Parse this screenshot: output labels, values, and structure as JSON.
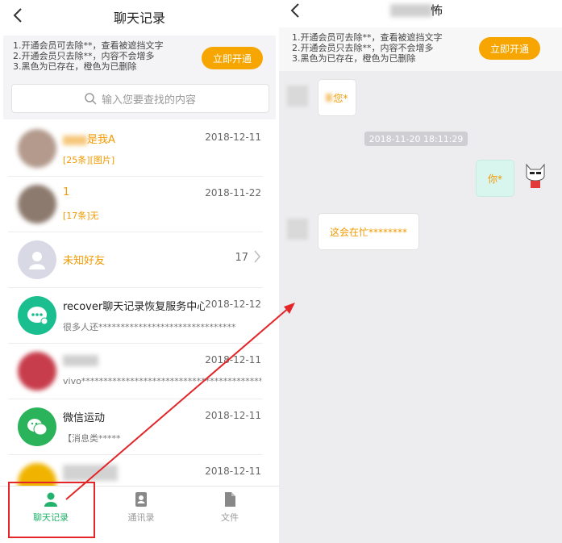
{
  "left": {
    "title": "聊天记录",
    "promo_lines": [
      "1.开通会员可去除**，查看被遮挡文字",
      "2.开通会员只去除**，内容不会增多",
      "3.黑色为已存在，橙色为已删除"
    ],
    "promo_button": "立即开通",
    "search_placeholder": "输入您要查找的内容",
    "chats": [
      {
        "name": "是我A",
        "sub": "[25条][图片]",
        "date": "2018-12-11",
        "deleted": true,
        "avatar": "#b39a8d"
      },
      {
        "name": "1",
        "sub": "[17条]无",
        "date": "2018-11-22",
        "deleted": true,
        "avatar": "#8d7a6e"
      },
      {
        "name": "未知好友",
        "sub": "",
        "count": "17",
        "deleted": true,
        "avatar": "#d9d9e6"
      },
      {
        "name": "recover聊天记录恢复服务中心",
        "sub": "很多人还*******************************",
        "date": "2018-12-12",
        "deleted": false,
        "avatar": "#1bbf8f"
      },
      {
        "name": "",
        "sub": "vivo******************************************",
        "date": "2018-12-11",
        "deleted": false,
        "avatar": "#c73d4b"
      },
      {
        "name": "微信运动",
        "sub": "【消息类*****",
        "date": "2018-12-11",
        "deleted": false,
        "avatar": "#2bb35c"
      },
      {
        "name": "",
        "sub": "",
        "date": "2018-12-11",
        "deleted": false,
        "avatar": "#f0b400"
      }
    ],
    "tabs": [
      {
        "label": "聊天记录",
        "icon": "person-icon",
        "active": true
      },
      {
        "label": "通讯录",
        "icon": "contacts-icon",
        "active": false
      },
      {
        "label": "文件",
        "icon": "file-icon",
        "active": false
      }
    ]
  },
  "right": {
    "title": "怖",
    "promo_lines": [
      "1.开通会员可去除**，查看被遮挡文字",
      "2.开通会员只去除**，内容不会增多",
      "3.黑色为已存在，橙色为已删除"
    ],
    "promo_button": "立即开通",
    "messages": [
      {
        "text": "您*",
        "side": "left"
      },
      {
        "text": "你*",
        "side": "right"
      },
      {
        "text": "这会在忙********",
        "side": "left"
      }
    ],
    "timestamp": "2018-11-20 18:11:29"
  },
  "colors": {
    "accent": "#f7a500",
    "active": "#21b36b",
    "highlight": "#e2262a",
    "deleted": "#f29a00"
  }
}
